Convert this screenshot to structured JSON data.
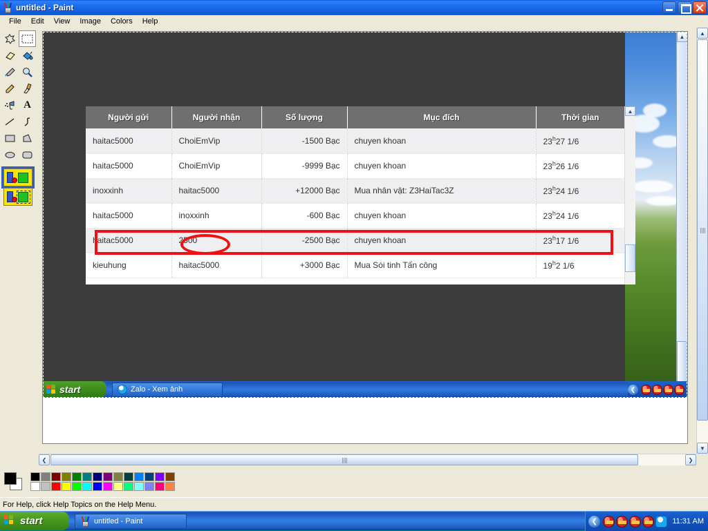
{
  "window": {
    "title": "untitled - Paint",
    "icon": "paint-cup-icon",
    "buttons": {
      "minimize": "_",
      "maximize": "❐",
      "close": "✕"
    }
  },
  "menu": {
    "items": [
      "File",
      "Edit",
      "View",
      "Image",
      "Colors",
      "Help"
    ]
  },
  "toolbox": {
    "tools": [
      {
        "name": "free-form-select",
        "glyph": "✧"
      },
      {
        "name": "rectangular-select",
        "glyph": "▭",
        "selected": true
      },
      {
        "name": "eraser",
        "glyph": "▱"
      },
      {
        "name": "fill-with-color",
        "glyph": "🪣"
      },
      {
        "name": "pick-color",
        "glyph": "✒"
      },
      {
        "name": "magnifier",
        "glyph": "🔍"
      },
      {
        "name": "pencil",
        "glyph": "✎"
      },
      {
        "name": "brush",
        "glyph": "🖌"
      },
      {
        "name": "airbrush",
        "glyph": "❋"
      },
      {
        "name": "text",
        "glyph": "A"
      },
      {
        "name": "line",
        "glyph": "╲"
      },
      {
        "name": "curve",
        "glyph": "∫"
      },
      {
        "name": "rectangle",
        "glyph": "▭"
      },
      {
        "name": "polygon",
        "glyph": "⬟"
      },
      {
        "name": "ellipse",
        "glyph": "⬭"
      },
      {
        "name": "rounded-rectangle",
        "glyph": "▢"
      }
    ],
    "options": [
      {
        "name": "opaque-selection",
        "selected": true
      },
      {
        "name": "transparent-selection",
        "selected": false
      }
    ]
  },
  "pasted_screenshot": {
    "table": {
      "columns": [
        "Người gửi",
        "Người nhận",
        "Số lượng",
        "Mục đích",
        "Thời gian"
      ],
      "rows": [
        {
          "sender": "haitac5000",
          "receiver": "ChoiEmVip",
          "amount": "-1500  Bạc",
          "purpose": "chuyen khoan",
          "time_h": "23",
          "time_m": "27 1/6"
        },
        {
          "sender": "haitac5000",
          "receiver": "ChoiEmVip",
          "amount": "-9999  Bạc",
          "purpose": "chuyen khoan",
          "time_h": "23",
          "time_m": "26 1/6"
        },
        {
          "sender": "inoxxinh",
          "receiver": "haitac5000",
          "amount": "+12000  Bạc",
          "purpose": "Mua nhân vật: Z3HaiTac3Z",
          "time_h": "23",
          "time_m": "24 1/6"
        },
        {
          "sender": "haitac5000",
          "receiver": "inoxxinh",
          "amount": "-600  Bạc",
          "purpose": "chuyen khoan",
          "time_h": "23",
          "time_m": "24 1/6"
        },
        {
          "sender": "haitac5000",
          "receiver": "2500",
          "amount": "-2500  Bạc",
          "purpose": "chuyen khoan",
          "time_h": "23",
          "time_m": "17 1/6"
        },
        {
          "sender": "kieuhung",
          "receiver": "haitac5000",
          "amount": "+3000  Bạc",
          "purpose": "Mua Sói tinh Tấn công",
          "time_h": "19",
          "time_m": "2 1/6"
        }
      ],
      "highlighted_row_index": 4,
      "annotation_color": "#ee1111"
    },
    "inner_taskbar": {
      "start_label": "start",
      "items": [
        {
          "label": "Zalo - Xem ảnh",
          "icon": "zalo-icon"
        }
      ],
      "tray_chevron": "❮",
      "tray_icons": [
        "game-ball-icon",
        "game-ball-icon",
        "game-ball-icon",
        "game-ball-icon"
      ]
    }
  },
  "scrollbars": {
    "up_arrow": "▲",
    "down_arrow": "▼",
    "left_arrow": "❮",
    "right_arrow": "❯"
  },
  "palette": {
    "foreground": "#000000",
    "background": "#ffffff",
    "row1": [
      "#000000",
      "#808080",
      "#800000",
      "#808000",
      "#008000",
      "#008080",
      "#000080",
      "#800080",
      "#808040",
      "#004040",
      "#0080ff",
      "#004080",
      "#8000ff",
      "#804000"
    ],
    "row2": [
      "#ffffff",
      "#c0c0c0",
      "#ff0000",
      "#ffff00",
      "#00ff00",
      "#00ffff",
      "#0000ff",
      "#ff00ff",
      "#ffff80",
      "#00ff80",
      "#80ffff",
      "#8080ff",
      "#ff0080",
      "#ff8040"
    ]
  },
  "statusbar": {
    "text": "For Help, click Help Topics on the Help Menu."
  },
  "taskbar": {
    "start_label": "start",
    "items": [
      {
        "label": "untitled - Paint",
        "icon": "paint-cup-icon"
      }
    ],
    "tray_chevron": "❮",
    "tray_icons": [
      "game-ball-icon",
      "game-ball-icon",
      "game-ball-icon",
      "game-ball-icon",
      "zalo-icon"
    ],
    "clock": "11:31 AM"
  }
}
